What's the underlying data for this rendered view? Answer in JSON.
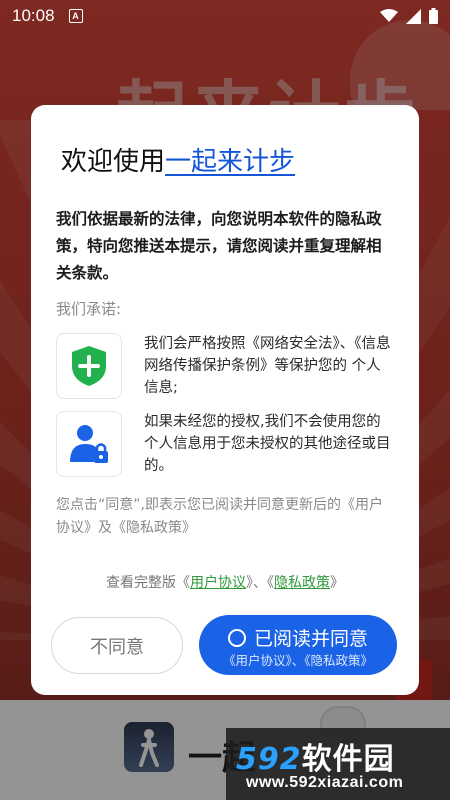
{
  "status_bar": {
    "time": "10:08",
    "notification_icon": "A"
  },
  "background": {
    "title": "一起来计步",
    "app_name": "一起"
  },
  "dialog": {
    "title_prefix": "欢迎使用",
    "title_brand": "一起来计步",
    "intro": "我们依据最新的法律，向您说明本软件的隐私政策，特向您推送本提示，请您阅读并重复理解相关条款。",
    "promise_label": "我们承诺:",
    "features": [
      {
        "icon": "shield-plus-icon",
        "text": "我们会严格按照《网络安全法》、《信息网络传播保护条例》等保护您的 个人信息;"
      },
      {
        "icon": "user-lock-icon",
        "text": "如果未经您的授权,我们不会使用您的个人信息用于您未授权的其他途径或目的。"
      }
    ],
    "consent_text": "您点击“同意”,即表示您已阅读并同意更新后的《用户协议》及《隐私政策》",
    "full_version": {
      "prefix": "查看完整版《",
      "user_agreement": "用户协议",
      "middle": "》、《",
      "privacy_policy": "隐私政策",
      "suffix": "》"
    },
    "disagree_button": "不同意",
    "agree_button": "已阅读并同意",
    "agree_subtext": "《用户协议》、《隐私政策》"
  },
  "watermark": {
    "brand_number": "592",
    "brand_text": "软件园",
    "url": "www.592xiazai.com"
  },
  "colors": {
    "accent_blue": "#1a62e6",
    "brand_link": "#1456d8",
    "link_green": "#2f9a3a",
    "shield_green": "#22b14c"
  }
}
